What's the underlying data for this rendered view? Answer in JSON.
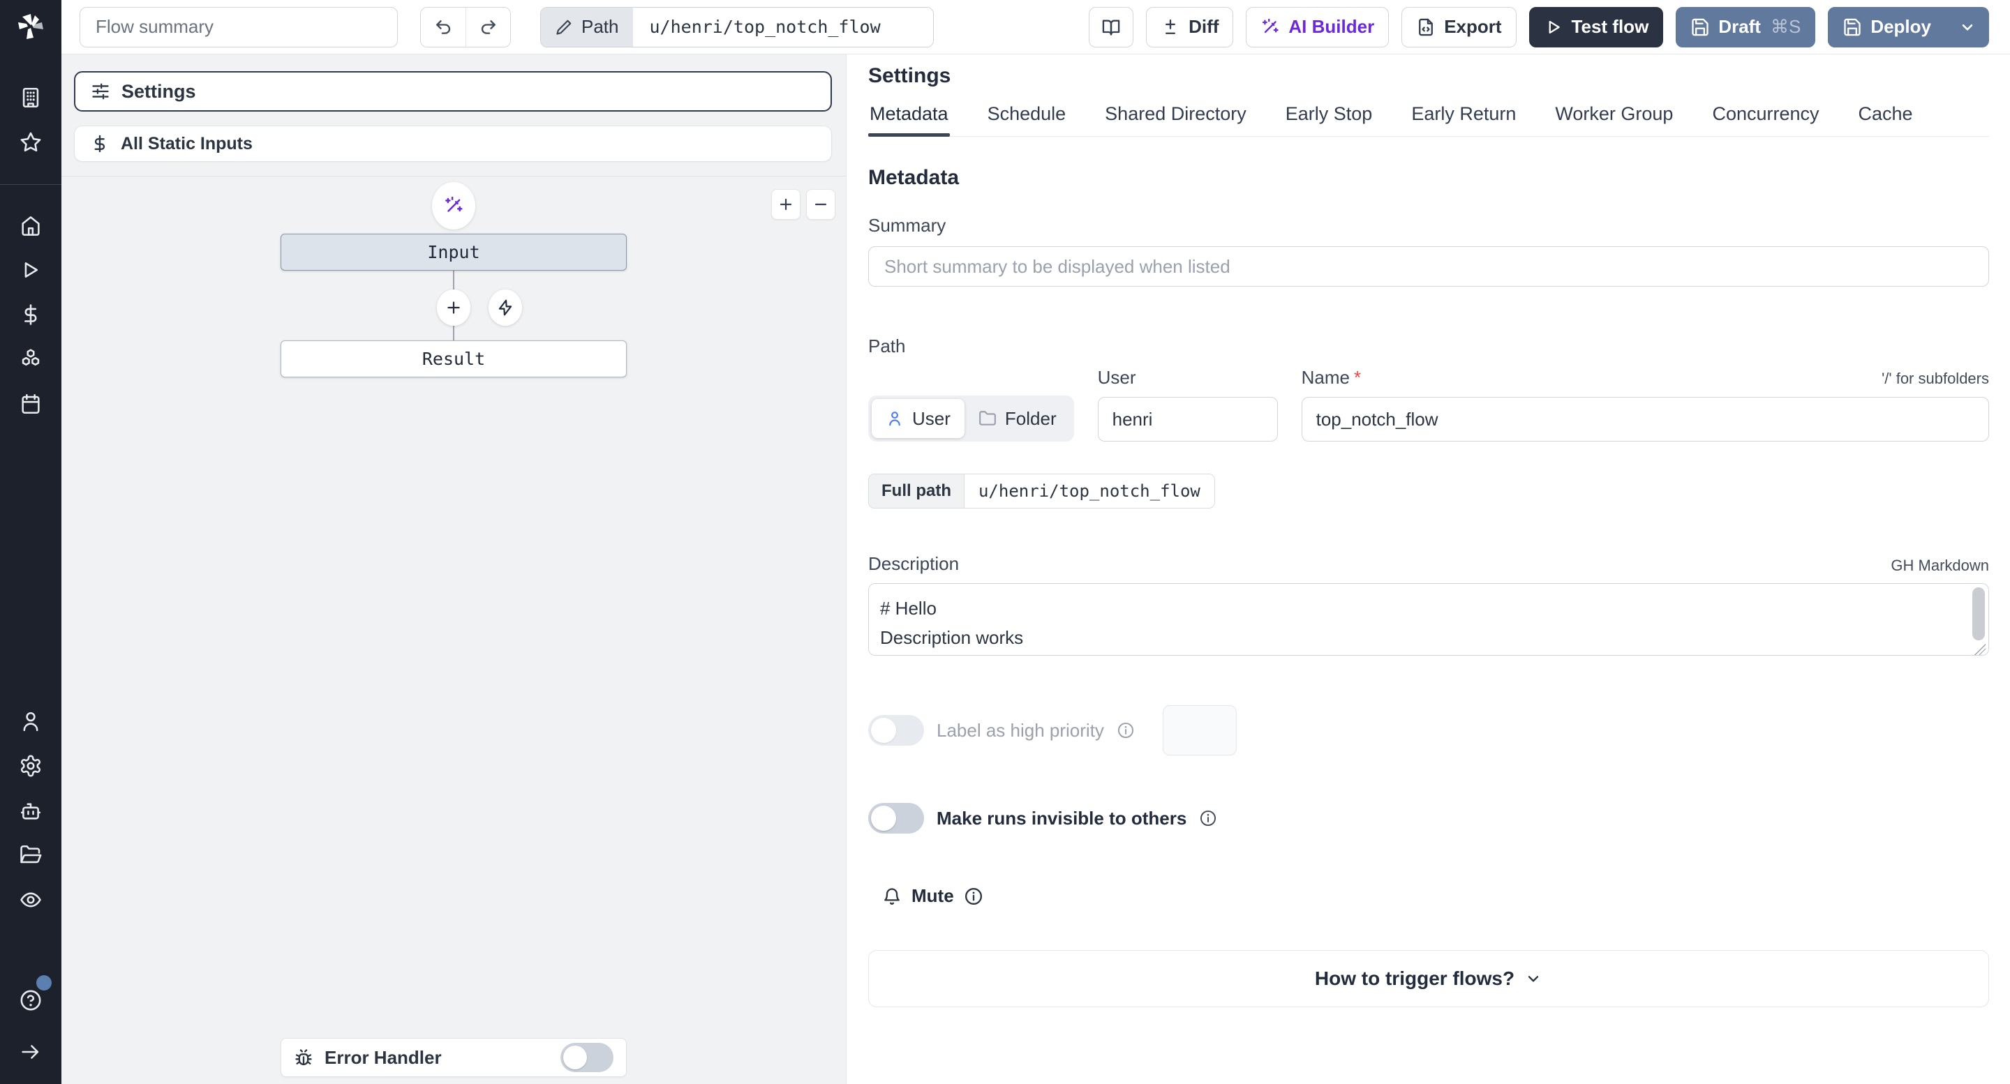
{
  "topbar": {
    "flow_summary_placeholder": "Flow summary",
    "path_button_label": "Path",
    "path_value": "u/henri/top_notch_flow",
    "diff_label": "Diff",
    "ai_builder_label": "AI Builder",
    "export_label": "Export",
    "test_flow_label": "Test flow",
    "draft_label": "Draft",
    "draft_shortcut": "⌘S",
    "deploy_label": "Deploy",
    "icons": [
      "windmill-logo-icon",
      "undo-icon",
      "redo-icon",
      "pencil-icon",
      "book-open-icon",
      "diff-icon",
      "wand-sparkles-icon",
      "file-export-icon",
      "play-icon",
      "save-icon",
      "chevron-down-icon"
    ]
  },
  "sidebar": {
    "icons": [
      "windmill-logo-icon",
      "building-icon",
      "star-icon",
      "home-icon",
      "play-icon",
      "dollar-icon",
      "boxes-icon",
      "calendar-icon",
      "user-icon",
      "gear-icon",
      "robot-icon",
      "folder-open-icon",
      "eye-icon",
      "help-icon",
      "arrow-right-icon"
    ]
  },
  "flow_panel": {
    "settings_card_label": "Settings",
    "static_inputs_label": "All Static Inputs",
    "input_node_label": "Input",
    "result_node_label": "Result",
    "error_handler_label": "Error Handler",
    "zoom_in_icon": "plus-icon",
    "zoom_out_icon": "minus-icon"
  },
  "settings_panel": {
    "title": "Settings",
    "tabs": [
      "Metadata",
      "Schedule",
      "Shared Directory",
      "Early Stop",
      "Early Return",
      "Worker Group",
      "Concurrency",
      "Cache"
    ],
    "active_tab": "Metadata",
    "metadata": {
      "heading": "Metadata",
      "summary_label": "Summary",
      "summary_placeholder": "Short summary to be displayed when listed",
      "path_label": "Path",
      "owner_user_label": "User",
      "owner_folder_label": "Folder",
      "user_field_label": "User",
      "user_value": "henri",
      "name_field_label": "Name",
      "name_required_mark": "*",
      "name_value": "top_notch_flow",
      "subfolder_hint": "'/' for subfolders",
      "full_path_label": "Full path",
      "full_path_value": "u/henri/top_notch_flow",
      "description_label": "Description",
      "markdown_hint": "GH Markdown",
      "description_value": "# Hello\nDescription works",
      "high_priority_label": "Label as high priority",
      "invisible_runs_label": "Make runs invisible to others",
      "mute_label": "Mute",
      "trigger_question": "How to trigger flows?"
    }
  },
  "colors": {
    "sidebar_bg": "#1c212c",
    "canvas_bg": "#f1f2f4",
    "dark_button": "#2b3342",
    "slate_button": "#60799c",
    "ai_purple": "#6d28d9",
    "user_icon_blue": "#4f7cf6",
    "required_red": "#ef4444",
    "input_node_fill": "#dde3ea",
    "active_tab_underline": "#3c4554",
    "help_badge_blue": "#5b7fae"
  }
}
